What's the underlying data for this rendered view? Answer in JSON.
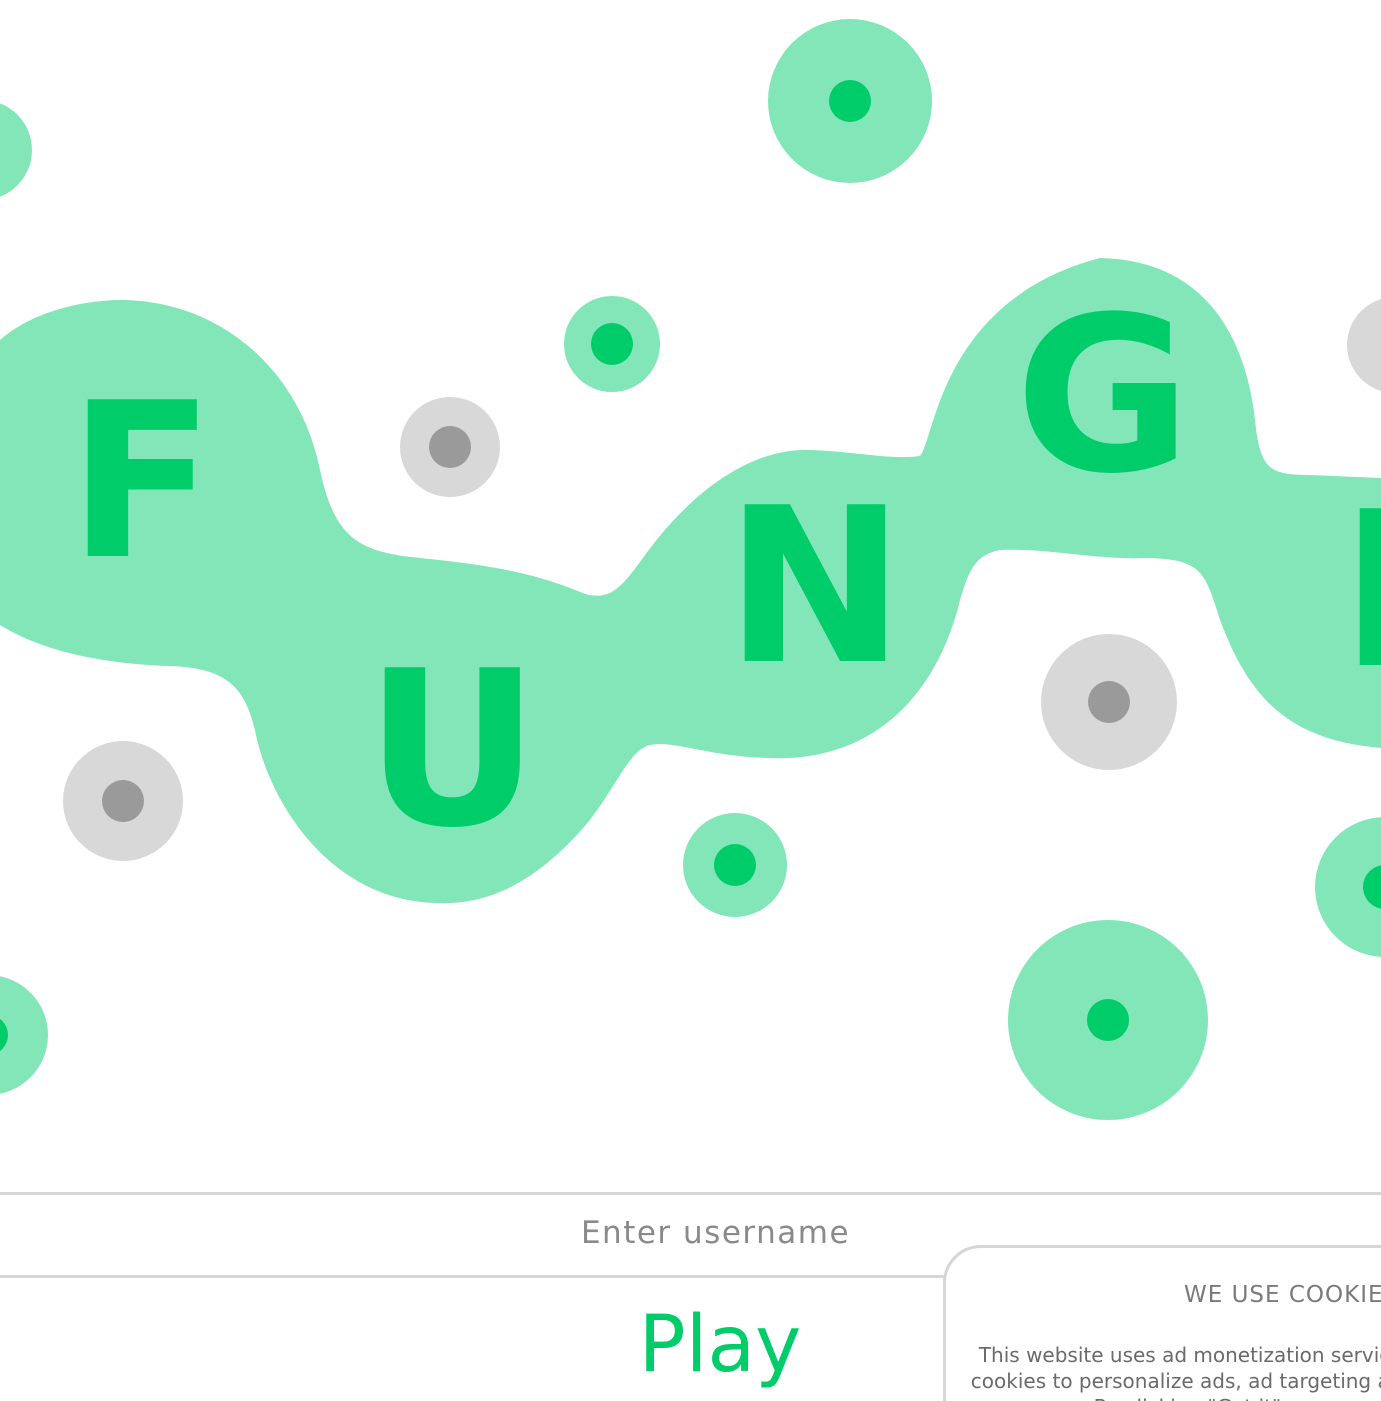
{
  "logo": {
    "letters": [
      "F",
      "U",
      "N",
      "G",
      "I"
    ],
    "colors": {
      "blob": "#82e6b8",
      "letter": "#00cc6a",
      "spore_green_outer": "#82e6b8",
      "spore_green_inner": "#00cc6a",
      "spore_gray_outer": "#d8d8d8",
      "spore_gray_inner": "#9a9a9a"
    }
  },
  "username": {
    "placeholder": "Enter username",
    "value": ""
  },
  "play": {
    "label": "Play"
  },
  "cookie_banner": {
    "title": "WE USE COOKIES",
    "body": "This website uses ad monetization services and uses cookies to personalize ads, ad targeting and analytics. By clicking \"Got it\" you agree."
  }
}
